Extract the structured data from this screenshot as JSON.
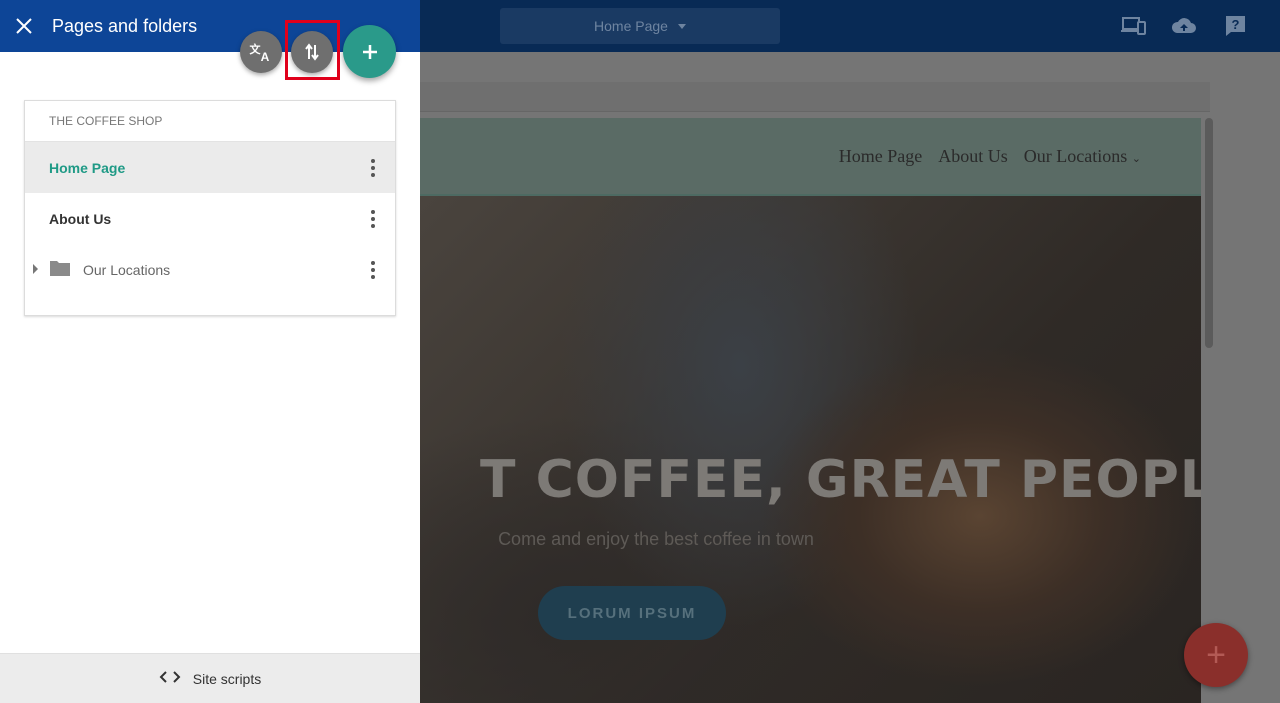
{
  "editor": {
    "page_selector": "Home Page",
    "icons": [
      "devices-icon",
      "cloud-upload-icon",
      "help-icon"
    ]
  },
  "site": {
    "nav": [
      "Home Page",
      "About Us",
      "Our Locations"
    ],
    "hero_title": "T COFFEE, GREAT PEOPLE",
    "hero_subtitle": "Come and enjoy the best coffee in town",
    "hero_button": "LORUM IPSUM",
    "fab_label": "+"
  },
  "panel": {
    "title": "Pages and folders",
    "actions": [
      "translate-icon",
      "sort-icon",
      "add-icon"
    ],
    "site_name": "THE COFFEE SHOP",
    "items": [
      {
        "label": "Home Page",
        "active": true,
        "type": "page"
      },
      {
        "label": "About Us",
        "active": false,
        "type": "page"
      },
      {
        "label": "Our Locations",
        "active": false,
        "type": "folder"
      }
    ],
    "footer_label": "Site scripts"
  },
  "colors": {
    "header": "#0d4597",
    "accent": "#2a9a8a",
    "highlight": "#e0001b"
  }
}
